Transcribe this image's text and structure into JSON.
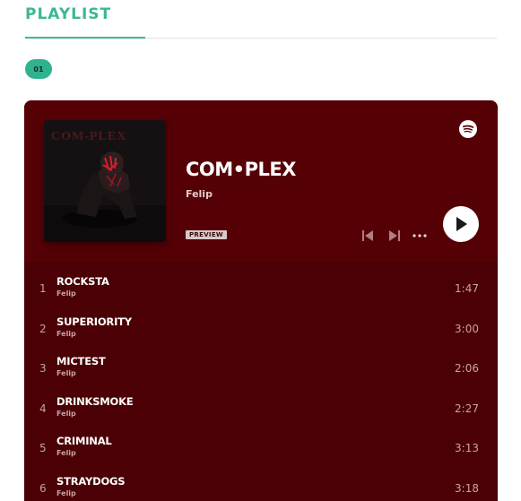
{
  "section": {
    "title": "PLAYLIST",
    "badge": "01"
  },
  "player": {
    "album_title": "COM•PLEX",
    "artist": "Felip",
    "preview_label": "PREVIEW",
    "cover_text": "COM-PLEX",
    "icons": {
      "brand": "spotify-icon",
      "prev": "skip-previous-icon",
      "next": "skip-next-icon",
      "more": "more-icon",
      "play": "play-icon"
    },
    "colors": {
      "background": "#4a0004",
      "header": "#550005",
      "accent": "#3bb896"
    }
  },
  "tracks": [
    {
      "num": "1",
      "name": "ROCKSTA",
      "artist": "Felip",
      "duration": "1:47"
    },
    {
      "num": "2",
      "name": "SUPERIORITY",
      "artist": "Felip",
      "duration": "3:00"
    },
    {
      "num": "3",
      "name": "MICTEST",
      "artist": "Felip",
      "duration": "2:06"
    },
    {
      "num": "4",
      "name": "DRINKSMOKE",
      "artist": "Felip",
      "duration": "2:27"
    },
    {
      "num": "5",
      "name": "CRIMINAL",
      "artist": "Felip",
      "duration": "3:13"
    },
    {
      "num": "6",
      "name": "STRAYDOGS",
      "artist": "Felip",
      "duration": "3:18"
    }
  ]
}
